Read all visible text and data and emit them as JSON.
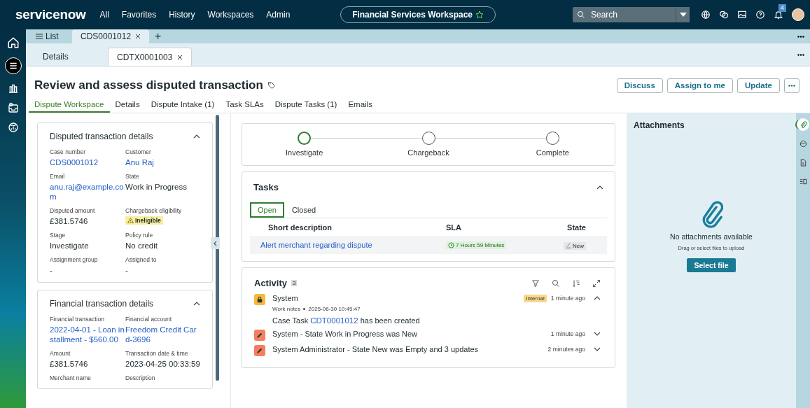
{
  "topnav": {
    "logo": "servicenow",
    "menu": [
      "All",
      "Favorites",
      "History",
      "Workspaces",
      "Admin"
    ],
    "workspace": "Financial Services Workspace",
    "search": {
      "placeholder": "Search"
    },
    "notifications": "4"
  },
  "tabs": [
    {
      "label": "List",
      "kind": "list",
      "selected": false
    },
    {
      "label": "CDS0001012",
      "kind": "record",
      "selected": true
    },
    {
      "label": "+",
      "kind": "add"
    }
  ],
  "subtabs": [
    {
      "label": "Details",
      "kind": "plain",
      "selected": false
    },
    {
      "label": "CDTX0001003",
      "kind": "record",
      "selected": true
    }
  ],
  "header": {
    "title": "Review and assess disputed transaction",
    "buttons": [
      "Discuss",
      "Assign to me",
      "Update"
    ]
  },
  "page_tabs": [
    {
      "label": "Dispute Workspace",
      "selected": true
    },
    {
      "label": "Details",
      "selected": false
    },
    {
      "label": "Dispute Intake (1)",
      "selected": false
    },
    {
      "label": "Task SLAs",
      "selected": false
    },
    {
      "label": "Dispute Tasks (1)",
      "selected": false
    },
    {
      "label": "Emails",
      "selected": false
    }
  ],
  "cards": [
    {
      "title": "Disputed transaction details",
      "expanded": true,
      "fields": [
        {
          "label": "Case number",
          "value": "CDS0001012",
          "kind": "link"
        },
        {
          "label": "Customer",
          "value": "Anu Raj",
          "kind": "link"
        },
        {
          "label": "Email",
          "value": "anu.raj@example.com",
          "kind": "link"
        },
        {
          "label": "State",
          "value": "Work in Progress",
          "kind": "text"
        },
        {
          "label": "Disputed amount",
          "value": "£381.5746",
          "kind": "text"
        },
        {
          "label": "Chargeback eligibility",
          "value": "Ineligible",
          "kind": "warning"
        },
        {
          "label": "Stage",
          "value": "Investigate",
          "kind": "text"
        },
        {
          "label": "Policy rule",
          "value": "No credit",
          "kind": "text"
        },
        {
          "label": "Assignment group",
          "value": "-",
          "kind": "text"
        },
        {
          "label": "Assigned to",
          "value": "-",
          "kind": "text"
        }
      ]
    },
    {
      "title": "Financial transaction details",
      "expanded": true,
      "fields": [
        {
          "label": "Financial transaction",
          "value": "2022-04-01 - Loan installment - $560.00",
          "kind": "link"
        },
        {
          "label": "Financial account",
          "value": "Freedom Credit Card-3696",
          "kind": "link"
        },
        {
          "label": "Amount",
          "value": "£381.5746",
          "kind": "text"
        },
        {
          "label": "Transaction date & time",
          "value": "2023-04-25 00:33:59",
          "kind": "text"
        },
        {
          "label": "Merchant name"
        },
        {
          "label": "Description"
        }
      ]
    }
  ],
  "stages": [
    {
      "label": "Investigate",
      "selected": true
    },
    {
      "label": "Chargeback",
      "selected": false
    },
    {
      "label": "Complete",
      "selected": false
    }
  ],
  "tasks": {
    "title": "Tasks",
    "expanded": true,
    "filters": [
      {
        "label": "Open",
        "selected": true
      },
      {
        "label": "Closed",
        "selected": false
      }
    ],
    "columns": [
      "Short description",
      "SLA",
      "State"
    ],
    "rows": [
      {
        "description": "Alert merchant regarding dispute",
        "sla": "7 Hours 59 Minutes",
        "state": "New"
      }
    ]
  },
  "activity": {
    "title": "Activity",
    "count": "3",
    "entries": [
      {
        "kind": "lock",
        "title": "System",
        "tag": "Internal",
        "time": "1 minute ago",
        "expanded": true,
        "meta": "Work notes",
        "date": "2025-06-30 10:45:47",
        "body": "Case Task ",
        "link": "CDT0001012",
        "body_end": " has been created"
      },
      {
        "kind": "edit",
        "title": "System - State Work in Progress was New",
        "time": "1 minute ago",
        "expanded": false
      },
      {
        "kind": "edit",
        "title": "System Administrator - State New was Empty and 3 updates",
        "time": "2 minutes ago",
        "expanded": false
      }
    ]
  },
  "attachments": {
    "title": "Attachments",
    "empty": "No attachments available",
    "hint": "Drag or select files to upload",
    "button": "Select file"
  },
  "side_rail": [
    {
      "kind": "clip",
      "selected": true
    },
    {
      "kind": "gauge",
      "selected": false
    },
    {
      "kind": "doc",
      "selected": false
    },
    {
      "kind": "list",
      "selected": false
    }
  ]
}
